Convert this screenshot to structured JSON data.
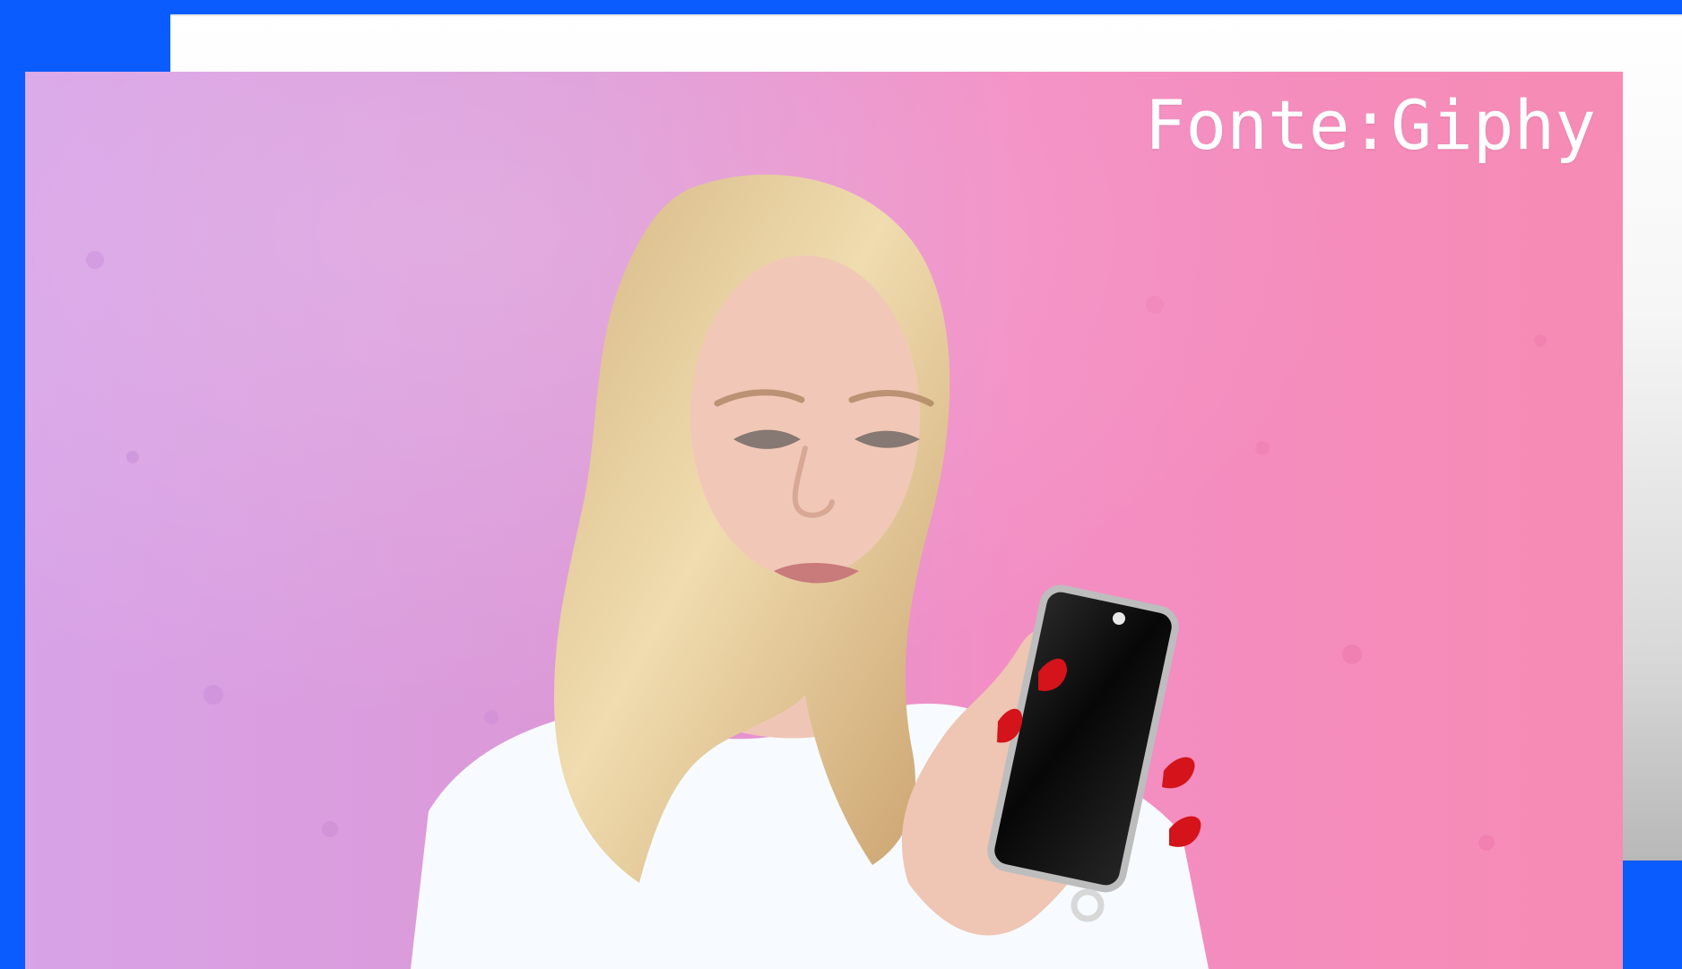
{
  "image": {
    "credit_text": "Fonte:Giphy",
    "subject": "woman-looking-at-phone",
    "colors": {
      "frame_blue": "#0b5cff",
      "bg_left": "#d59ee5",
      "bg_right": "#f68cb3",
      "hair": "#e3cc9d",
      "skin": "#f2c7b6",
      "shirt": "#f7fbff",
      "phone": "#111111",
      "nails": "#d5131a"
    }
  }
}
